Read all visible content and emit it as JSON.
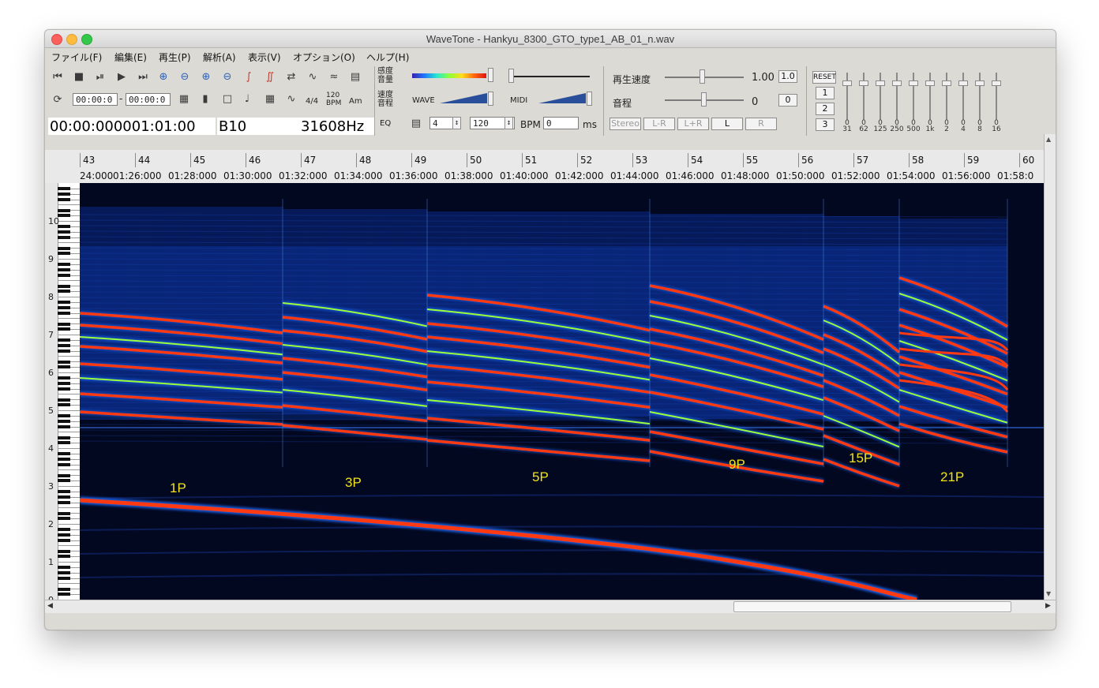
{
  "window": {
    "title": "WaveTone - Hankyu_8300_GTO_type1_AB_01_n.wav"
  },
  "menu": [
    {
      "label": "ファイル(F)"
    },
    {
      "label": "編集(E)"
    },
    {
      "label": "再生(P)"
    },
    {
      "label": "解析(A)"
    },
    {
      "label": "表示(V)"
    },
    {
      "label": "オプション(O)"
    },
    {
      "label": "ヘルプ(H)"
    }
  ],
  "toolbar": {
    "range_start": "00:00:0",
    "range_sep": "-",
    "range_end": "00:00:0",
    "time_sig": "4/4",
    "bpm_icon_top": "120",
    "bpm_icon_bottom": "BPM",
    "chord_icon": "Am"
  },
  "status": {
    "position": "00:00:000001:01:00",
    "note": "B10",
    "frequency": "31608Hz",
    "eq_label": "EQ"
  },
  "controls": {
    "sensitivity_label": [
      "感度",
      "音量"
    ],
    "speed_pitch_label": [
      "速度",
      "音程"
    ],
    "wave_label": "WAVE",
    "midi_label": "MIDI",
    "beats_value": "4",
    "bpm_value": "120",
    "bpm_label": "BPM",
    "offset_value": "0",
    "ms_label": "ms",
    "speed_label": "再生速度",
    "speed_value": "1.00",
    "speed_reset": "1.0",
    "pitch_label": "音程",
    "pitch_value": "0",
    "pitch_reset": "0",
    "channel_buttons": [
      "Stereo",
      "L-R",
      "L+R",
      "L",
      "R"
    ],
    "eq_reset": "RESET",
    "eq_presets": [
      "1",
      "2",
      "3"
    ],
    "eq_bands": [
      {
        "value": "0",
        "freq": "31"
      },
      {
        "value": "0",
        "freq": "62"
      },
      {
        "value": "0",
        "freq": "125"
      },
      {
        "value": "0",
        "freq": "250"
      },
      {
        "value": "0",
        "freq": "500"
      },
      {
        "value": "0",
        "freq": "1k"
      },
      {
        "value": "0",
        "freq": "2"
      },
      {
        "value": "0",
        "freq": "4"
      },
      {
        "value": "0",
        "freq": "8"
      },
      {
        "value": "0",
        "freq": "16"
      }
    ]
  },
  "ruler": {
    "bars": [
      "43",
      "44",
      "45",
      "46",
      "47",
      "48",
      "49",
      "50",
      "51",
      "52",
      "53",
      "54",
      "55",
      "56",
      "57",
      "58",
      "59",
      "60"
    ],
    "times": [
      "24:000",
      "01:26:000",
      "01:28:000",
      "01:30:000",
      "01:32:000",
      "01:34:000",
      "01:36:000",
      "01:38:000",
      "01:40:000",
      "01:42:000",
      "01:44:000",
      "01:46:000",
      "01:48:000",
      "01:50:000",
      "01:52:000",
      "01:54:000",
      "01:56:000",
      "01:58:0"
    ]
  },
  "octaves": [
    "10",
    "9",
    "8",
    "7",
    "6",
    "5",
    "4",
    "3",
    "2",
    "1",
    "0"
  ],
  "annotations": [
    {
      "label": "1P"
    },
    {
      "label": "3P"
    },
    {
      "label": "5P"
    },
    {
      "label": "9P"
    },
    {
      "label": "15P"
    },
    {
      "label": "21P"
    }
  ],
  "colors": {
    "spectrogram_bg": "#030821",
    "harmonic_strong": "#ff3a12",
    "harmonic_mid": "#9cff3a",
    "harmonic_weak": "#1f6cff",
    "annotation": "#f2e21b"
  }
}
